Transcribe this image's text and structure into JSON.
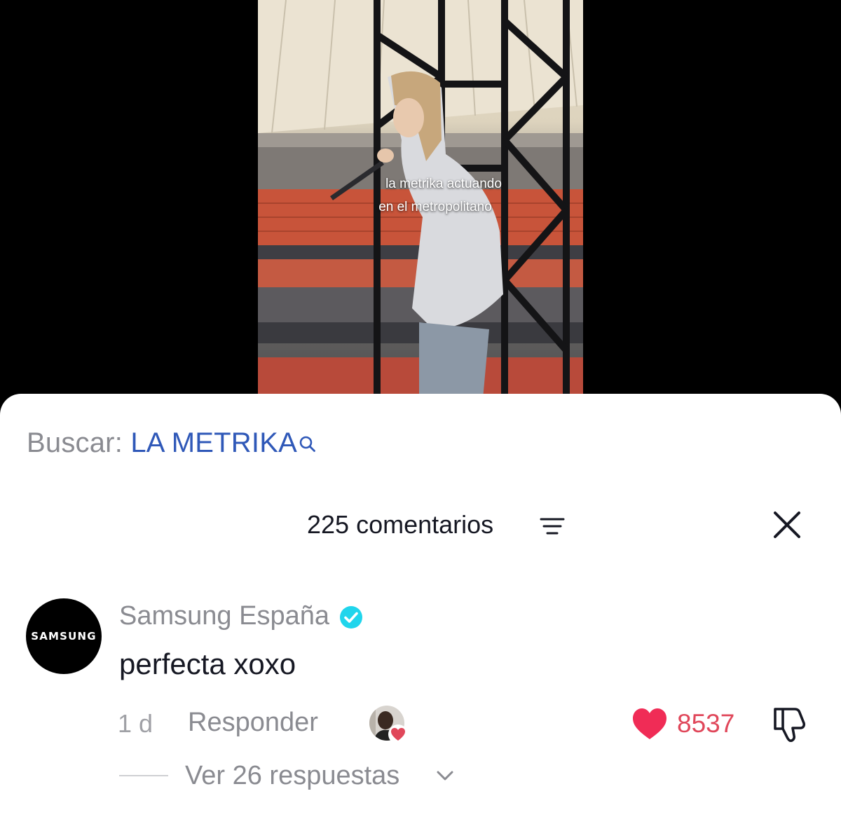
{
  "video": {
    "caption_line1": "la metrika actuando",
    "caption_line2": "en el metropolitano"
  },
  "search": {
    "prefix": "Buscar:",
    "term": "LA METRIKA",
    "icon": "search-icon"
  },
  "comments": {
    "title": "225 comentarios",
    "sort_icon": "sort-lines-icon",
    "close_icon": "close-icon"
  },
  "comment": {
    "avatar_text": "SAMSUNG",
    "username": "Samsung España",
    "verified": true,
    "text": "perfecta xoxo",
    "time": "1 d",
    "reply_label": "Responder",
    "like_count": "8537",
    "view_replies": "Ver 26 respuestas"
  },
  "colors": {
    "search_term": "#2f58b8",
    "like": "#e0475a",
    "verified": "#20d5ec"
  }
}
